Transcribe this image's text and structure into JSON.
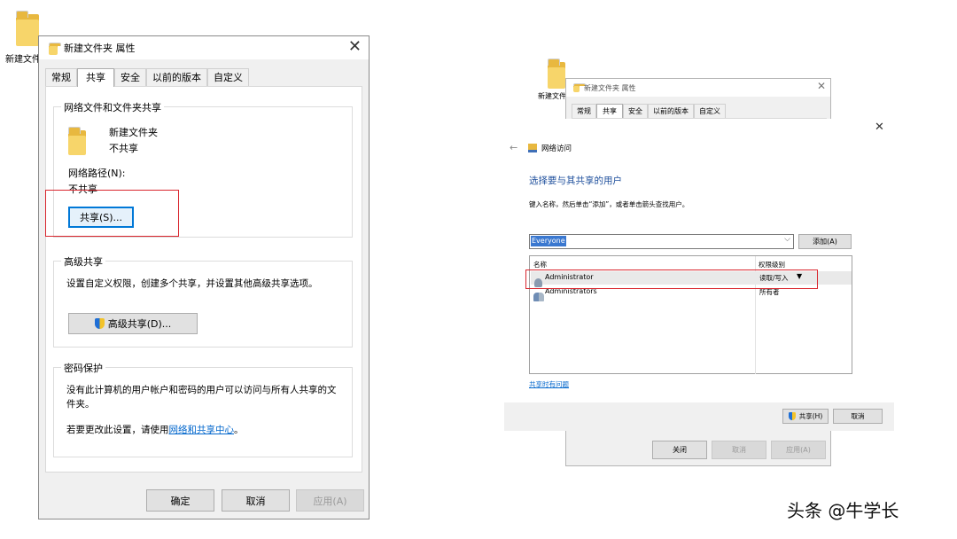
{
  "desktop": {
    "left_folder_label": "新建文件",
    "right_folder_label": "新建文件"
  },
  "props_dialog": {
    "title": "新建文件夹 属性",
    "tabs": [
      "常规",
      "共享",
      "安全",
      "以前的版本",
      "自定义"
    ],
    "active_tab": "共享",
    "network_group": {
      "legend": "网络文件和文件夹共享",
      "folder_name": "新建文件夹",
      "folder_status": "不共享",
      "path_label": "网络路径(N):",
      "path_value": "不共享",
      "share_button": "共享(S)..."
    },
    "advanced_group": {
      "legend": "高级共享",
      "description": "设置自定义权限，创建多个共享，并设置其他高级共享选项。",
      "button": "高级共享(D)..."
    },
    "password_group": {
      "legend": "密码保护",
      "description_line1": "没有此计算机的用户帐户和密码的用户可以访问与所有人共享的文",
      "description_line2": "件夹。",
      "change_prefix": "若要更改此设置，请使用",
      "change_link": "网络和共享中心",
      "change_suffix": "。"
    },
    "buttons": {
      "ok": "确定",
      "cancel": "取消",
      "apply": "应用(A)"
    }
  },
  "small_props_dialog": {
    "title": "新建文件夹 属性",
    "tabs": [
      "常规",
      "共享",
      "安全",
      "以前的版本",
      "自定义"
    ],
    "buttons": {
      "close": "关闭",
      "cancel": "取消",
      "apply": "应用(A)"
    }
  },
  "network_access": {
    "breadcrumb": "网络访问",
    "heading": "选择要与其共享的用户",
    "instruction": "键入名称，然后单击“添加”，或者单击箭头查找用户。",
    "input_value": "Everyone",
    "add_button": "添加(A)",
    "columns": [
      "名称",
      "权限级别"
    ],
    "rows": [
      {
        "name": "Administrator",
        "permission": "读取/写入"
      },
      {
        "name": "Administrators",
        "permission": "所有者"
      }
    ],
    "help_link": "共享时有问题",
    "share_button": "共享(H)",
    "cancel_button": "取消"
  },
  "watermark": "头条 @牛学长"
}
